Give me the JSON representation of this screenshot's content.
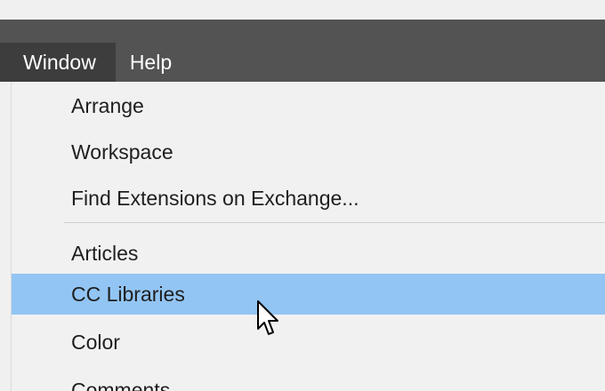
{
  "menubar": {
    "items": [
      {
        "label": "Window"
      },
      {
        "label": "Help"
      }
    ]
  },
  "dropdown": {
    "items": [
      {
        "label": "Arrange"
      },
      {
        "label": "Workspace"
      },
      {
        "label": "Find Extensions on Exchange..."
      },
      {
        "label": "Articles"
      },
      {
        "label": "CC Libraries"
      },
      {
        "label": "Color"
      },
      {
        "label": "Comments"
      }
    ],
    "highlighted_item": "CC Libraries"
  },
  "colors": {
    "menubar_bg": "#535353",
    "active_menu_bg": "#3d3d3d",
    "dropdown_bg": "#f1f1f1",
    "highlight": "#92c5f3"
  },
  "cursor": {
    "icon": "arrow-pointer-icon"
  }
}
